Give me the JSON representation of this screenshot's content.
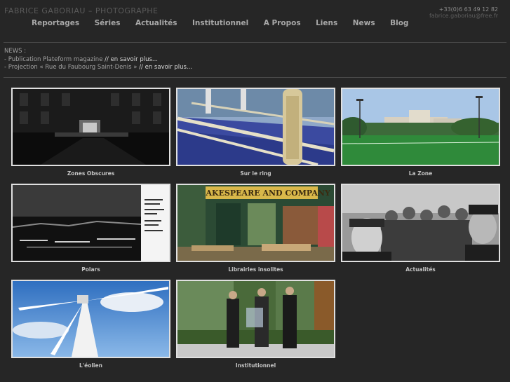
{
  "header": {
    "site_title": "FABRICE GABORIAU – PHOTOGRAPHE",
    "phone": "+33(0)6 63 49 12 82",
    "email": "fabrice.gaboriau@free.fr"
  },
  "nav": {
    "items": [
      "Reportages",
      "Séries",
      "Actualités",
      "Institutionnel",
      "A Propos",
      "Liens",
      "News",
      "Blog"
    ]
  },
  "news": {
    "heading": "NEWS :",
    "items": [
      {
        "text": "- Publication Plateform magazine",
        "link": "// en savoir plus..."
      },
      {
        "text": "- Projection « Rue du Faubourg Saint-Denis »",
        "link": "// en savoir plus..."
      }
    ]
  },
  "gallery": {
    "items": [
      {
        "caption": "Zones Obscures"
      },
      {
        "caption": "Sur le ring"
      },
      {
        "caption": "La Zone"
      },
      {
        "caption": "Polars"
      },
      {
        "caption": "Librairies insolites",
        "sign": "SHAKESPEARE AND COMPANY"
      },
      {
        "caption": "Actualités"
      },
      {
        "caption": "L'éolien"
      },
      {
        "caption": "Institutionnel"
      }
    ]
  }
}
